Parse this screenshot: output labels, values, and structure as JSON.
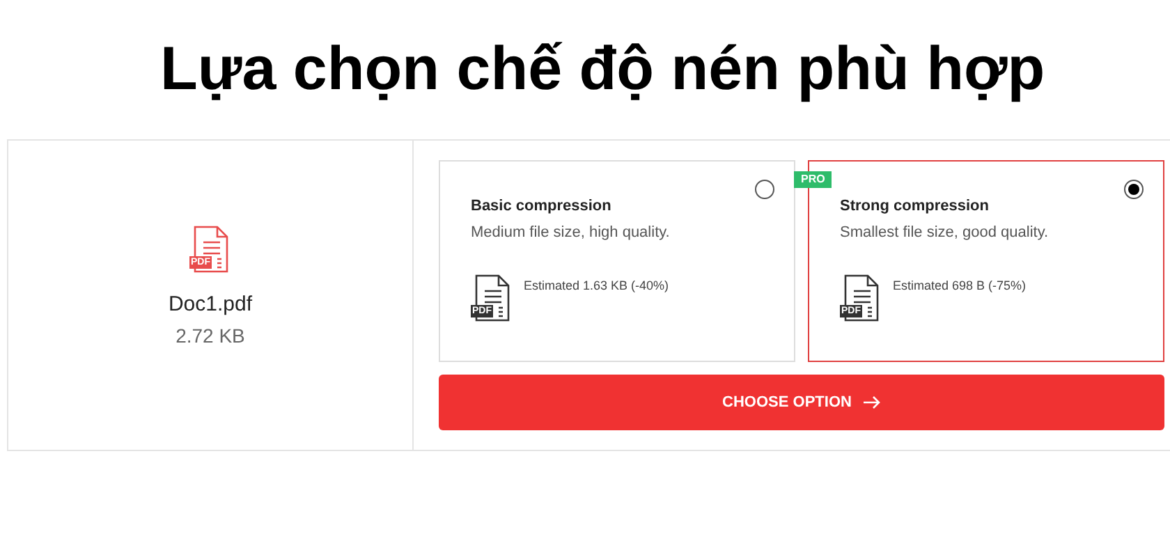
{
  "heading": "Lựa chọn chế độ nén phù hợp",
  "file": {
    "name": "Doc1.pdf",
    "size": "2.72 KB",
    "icon_label": "PDF"
  },
  "options": [
    {
      "title": "Basic compression",
      "description": "Medium file size, high quality.",
      "estimate": "Estimated 1.63 KB (-40%)",
      "icon_label": "PDF",
      "selected": false
    },
    {
      "title": "Strong compression",
      "description": "Smallest file size, good quality.",
      "estimate": "Estimated 698 B (-75%)",
      "icon_label": "PDF",
      "selected": true,
      "badge": "PRO"
    }
  ],
  "button": {
    "label": "CHOOSE OPTION"
  }
}
